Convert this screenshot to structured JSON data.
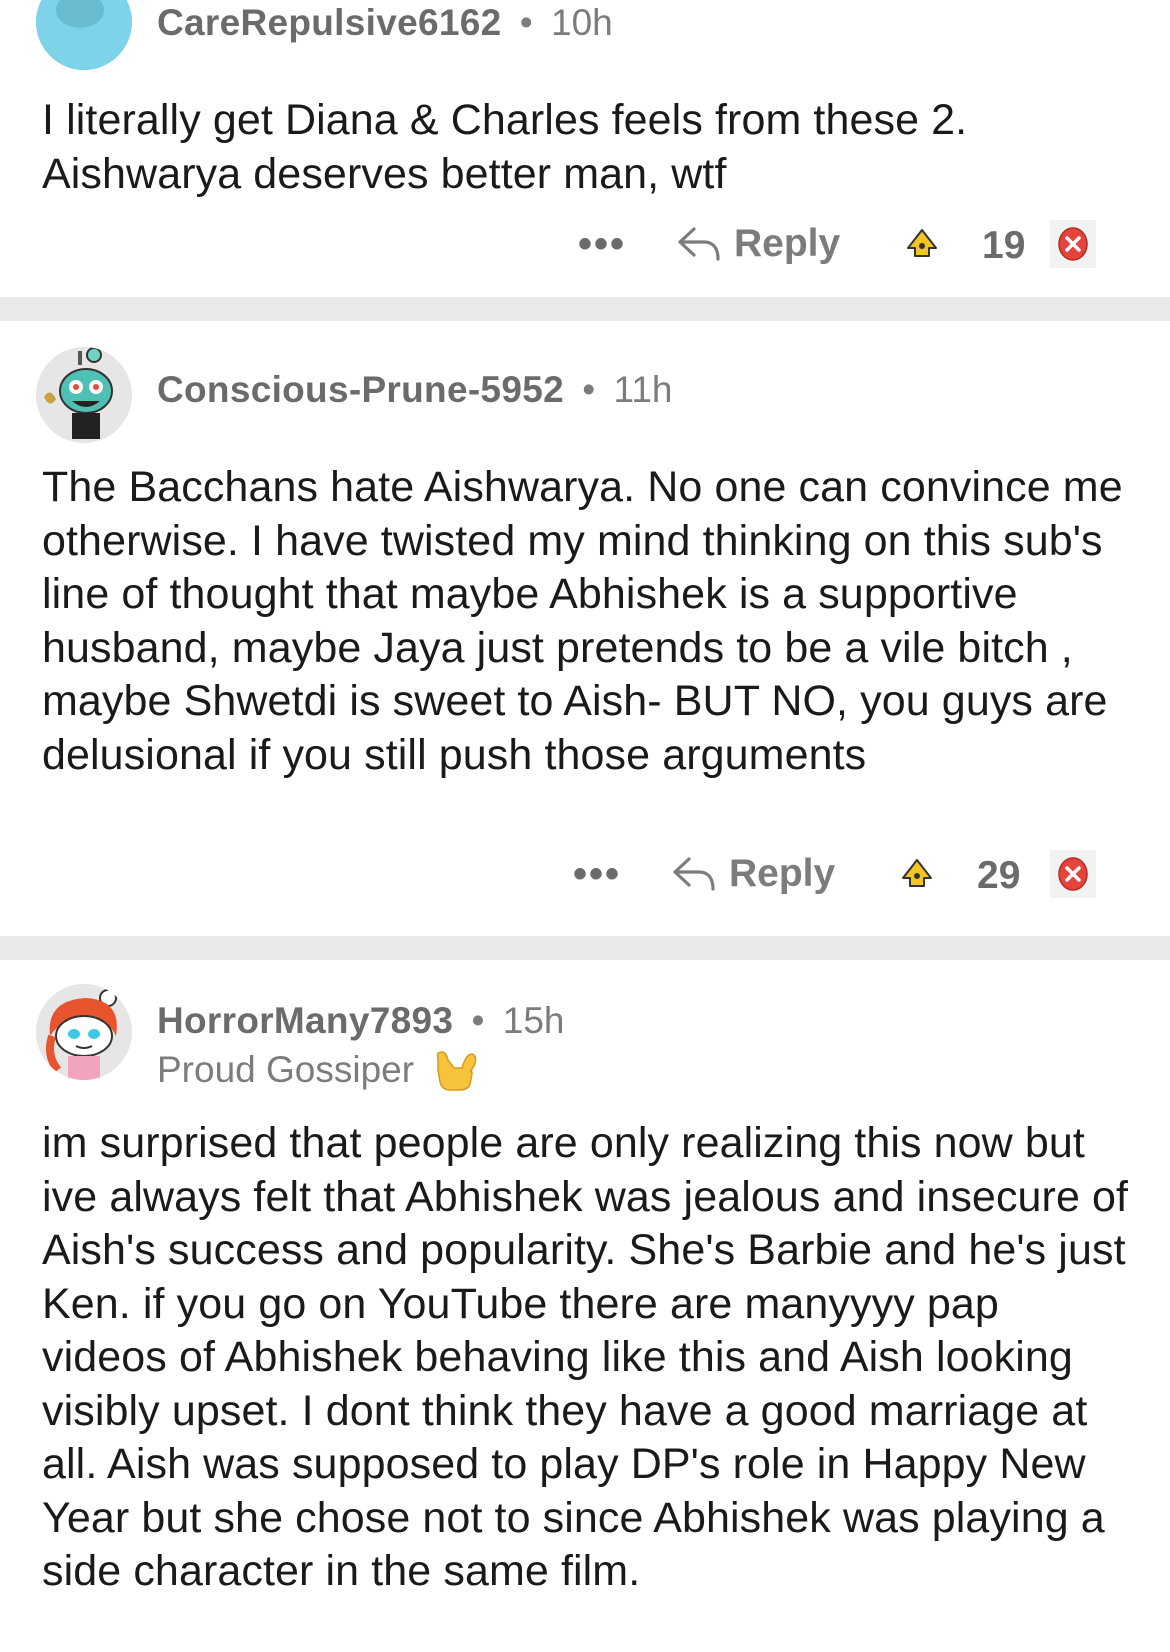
{
  "comments": [
    {
      "username": "CareRepulsive6162",
      "separator": "•",
      "time": "10h",
      "flair": "",
      "body": "I literally get Diana & Charles feels from these 2. Aishwarya deserves better man, wtf",
      "more_label": "•••",
      "reply_label": "Reply",
      "score": "19"
    },
    {
      "username": "Conscious-Prune-5952",
      "separator": "•",
      "time": "11h",
      "flair": "",
      "body": "The Bacchans hate Aishwarya. No one can convince me otherwise. I have twisted my mind thinking on this sub's line of thought that maybe Abhishek is a supportive husband, maybe Jaya just pretends to be a vile bitch , maybe Shwetdi is sweet to Aish- BUT NO, you guys are delusional if you still push those arguments",
      "more_label": "•••",
      "reply_label": "Reply",
      "score": "29"
    },
    {
      "username": "HorrorMany7893",
      "separator": "•",
      "time": "15h",
      "flair": "Proud Gossiper",
      "body": "im surprised that people are only realizing this now but ive always felt that Abhishek was jealous and insecure of Aish's success and popularity. She's Barbie and he's just Ken. if you go on YouTube there are manyyyy pap videos of Abhishek behaving like this and Aish looking visibly upset. I dont think they have a good marriage at all. Aish was supposed to play DP's role in Happy New Year but she chose not to since Abhishek was playing a side character in the same film."
    }
  ],
  "icons": {
    "avatar1": "snoo-avatar-cyan",
    "avatar2": "snoo-avatar-robot",
    "avatar3": "snoo-avatar-redhair",
    "flair_emoji": "call-me-hand-emoji",
    "reply": "reply-arrow-icon",
    "upvote": "upvote-icon",
    "downvote": "downvote-x-icon"
  },
  "colors": {
    "divider": "#e9e9ea",
    "meta_text": "#7c7c7c",
    "body_text": "#1a1a1b",
    "downvote_red": "#e4443b",
    "upvote_yellow": "#f3c623"
  }
}
